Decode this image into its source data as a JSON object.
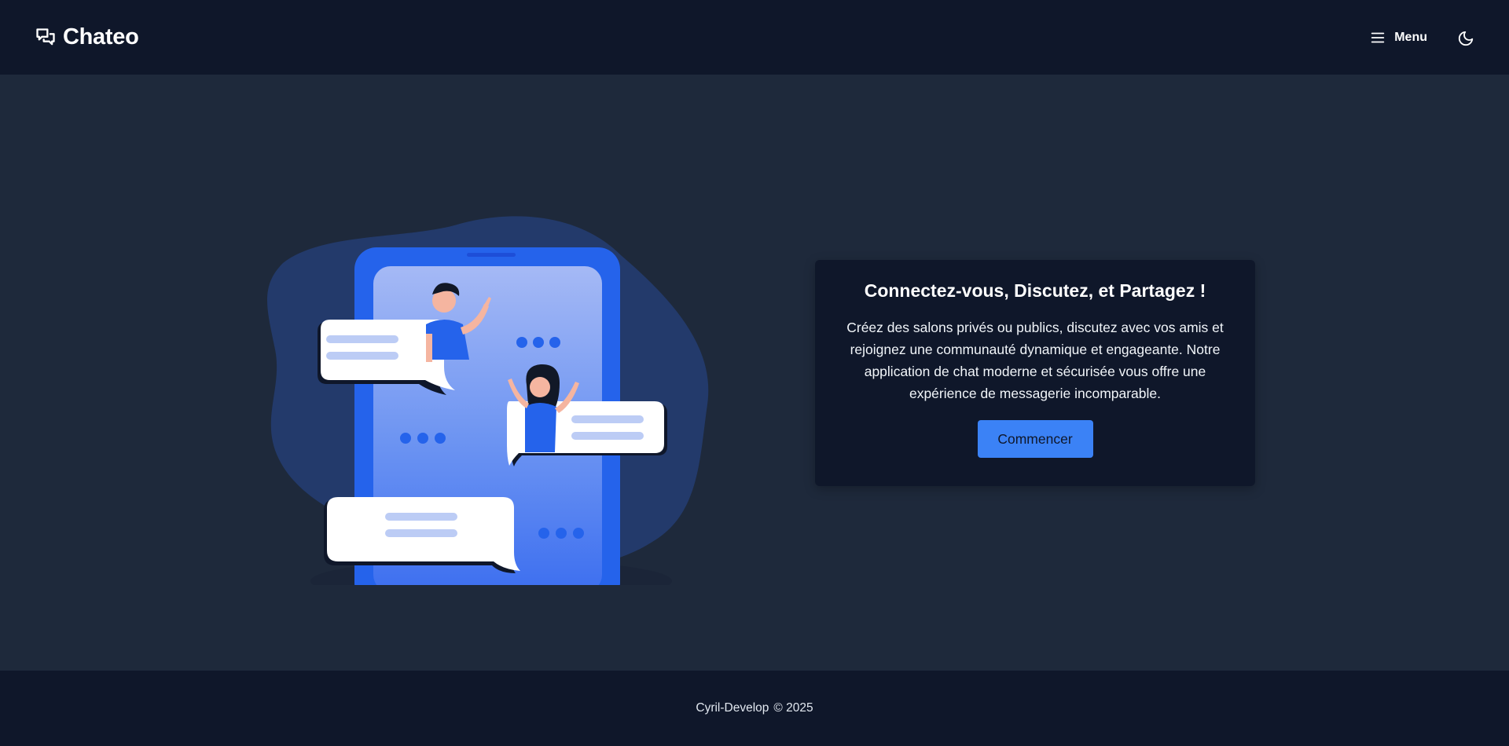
{
  "header": {
    "brand": "Chateo",
    "brand_icon": "chat-bubbles-icon",
    "menu_label": "Menu",
    "menu_icon": "hamburger-icon",
    "theme_icon": "moon-icon"
  },
  "hero": {
    "illustration": "phone-chat-illustration",
    "title": "Connectez-vous, Discutez, et Partagez !",
    "description": "Créez des salons privés ou publics, discutez avec vos amis et rejoignez une communauté dynamique et engageante. Notre application de chat moderne et sécurisée vous offre une expérience de messagerie incomparable.",
    "cta_label": "Commencer"
  },
  "footer": {
    "author": "Cyril-Develop",
    "copyright": "© 2025"
  },
  "colors": {
    "header_bg": "#0f172a",
    "page_bg": "#1e293b",
    "card_bg": "#0f172a",
    "accent": "#3b82f6",
    "phone": "#2563eb"
  }
}
